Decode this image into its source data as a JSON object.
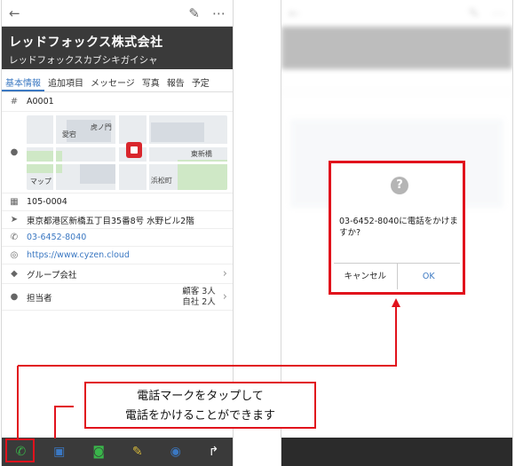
{
  "left_phone": {
    "company_name": "レッドフォックス株式会社",
    "company_kana": "レッドフォックスカブシキガイシャ",
    "tabs": [
      "基本情報",
      "追加項目",
      "メッセージ",
      "写真",
      "報告",
      "予定"
    ],
    "code": "A0001",
    "map_labels": {
      "aigo": "愛宕",
      "tokyo_tower_north": "虎ノ門",
      "nishiki": "東新橋",
      "apple_maps": "マップ",
      "hamarikyu": "浜松町"
    },
    "postal": "105-0004",
    "address": "東京都港区新橋五丁目35番8号 水野ビル2階",
    "phone": "03-6452-8040",
    "website": "https://www.cyzen.cloud",
    "group": "グループ会社",
    "assignee_label": "担当者",
    "assignee_counts": [
      "顧客 3人",
      "自社 2人"
    ]
  },
  "dialog": {
    "icon": "?",
    "message": "03-6452-8040に電話をかけますか?",
    "cancel": "キャンセル",
    "ok": "OK"
  },
  "callout_lines": [
    "電話マークをタップして",
    "電話をかけることができます"
  ],
  "colors": {
    "accent": "#e1121c",
    "link": "#3b78c2",
    "header": "#3a3a3a",
    "bottom_icon_green": "#39b54a",
    "bottom_icon_blue": "#3b78c2"
  }
}
